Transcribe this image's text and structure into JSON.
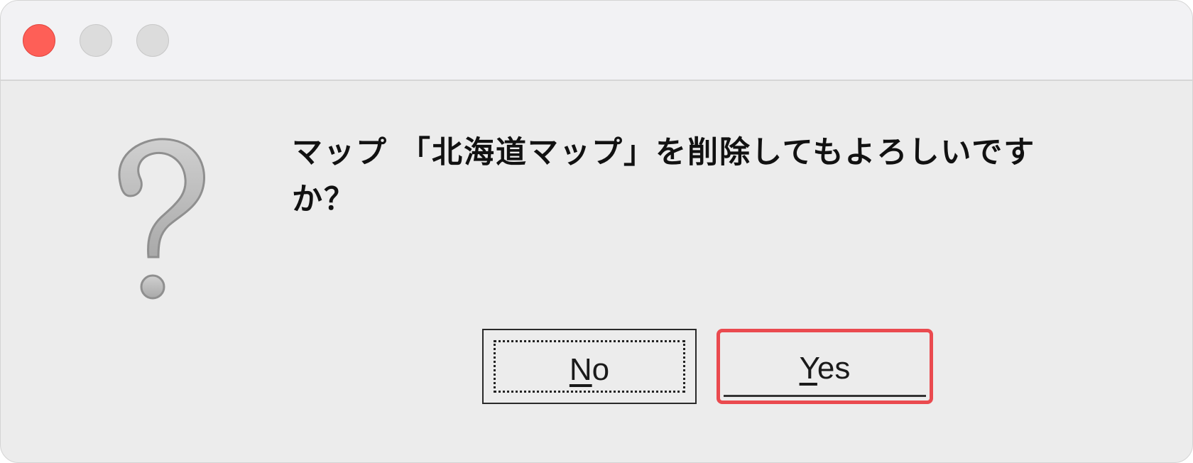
{
  "window": {
    "controls": {
      "close": "close-button",
      "minimize": "minimize-button",
      "zoom": "zoom-button"
    },
    "colors": {
      "close": "#fe5f57",
      "inactive": "#dcdcdc",
      "highlight": "#ea4a4f"
    }
  },
  "dialog": {
    "icon": "question-mark-icon",
    "message": "マップ 「北海道マップ」を削除してもよろしいですか？",
    "buttons": {
      "no": {
        "mnemonic": "N",
        "rest": "o"
      },
      "yes": {
        "mnemonic": "Y",
        "rest": "es"
      }
    }
  }
}
